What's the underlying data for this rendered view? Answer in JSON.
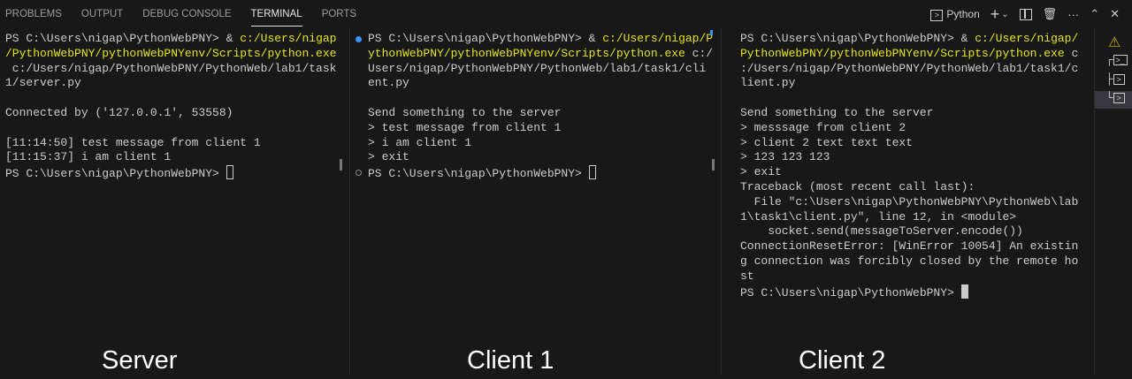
{
  "tabs": [
    {
      "label": "PROBLEMS"
    },
    {
      "label": "OUTPUT"
    },
    {
      "label": "DEBUG CONSOLE"
    },
    {
      "label": "TERMINAL",
      "active": true
    },
    {
      "label": "PORTS"
    }
  ],
  "toolbar": {
    "terminal_name": "Python",
    "icons": [
      "terminal-icon",
      "plus-icon",
      "chevron-down-icon",
      "split-icon",
      "trash-icon",
      "ellipsis-icon",
      "chevron-up-icon",
      "close-icon"
    ]
  },
  "colors": {
    "path_yellow": "#e5e510",
    "success_dot": "#3794ff",
    "background": "#181818"
  },
  "panes": [
    {
      "name": "server",
      "caption": "Server",
      "lines": [
        [
          {
            "t": "PS C:\\Users\\nigap\\PythonWebPNY> & "
          },
          {
            "t": "c:/Users/nigap",
            "y": true
          }
        ],
        [
          {
            "t": "/PythonWebPNY/pythonWebPNYenv/Scripts/python.exe",
            "y": true
          }
        ],
        [
          {
            "t": " c:/Users/nigap/PythonWebPNY/PythonWeb/lab1/task"
          }
        ],
        [
          {
            "t": "1/server.py"
          }
        ],
        [
          {
            "t": ""
          }
        ],
        [
          {
            "t": "Connected by ('127.0.0.1', 53558)"
          }
        ],
        [
          {
            "t": ""
          }
        ],
        [
          {
            "t": "[11:14:50] test message from client 1"
          }
        ],
        [
          {
            "t": "[11:15:37] i am client 1"
          }
        ],
        [
          {
            "t": "PS C:\\Users\\nigap\\PythonWebPNY> "
          }
        ]
      ]
    },
    {
      "name": "client-1",
      "caption": "Client 1",
      "lines": [
        [
          {
            "t": "PS C:\\Users\\nigap\\PythonWebPNY> & "
          },
          {
            "t": "c:/Users/nigap/P",
            "y": true
          }
        ],
        [
          {
            "t": "ythonWebPNY/pythonWebPNYenv/Scripts/python.exe",
            "y": true
          },
          {
            "t": " c:/"
          }
        ],
        [
          {
            "t": "Users/nigap/PythonWebPNY/PythonWeb/lab1/task1/cli"
          }
        ],
        [
          {
            "t": "ent.py"
          }
        ],
        [
          {
            "t": ""
          }
        ],
        [
          {
            "t": "Send something to the server"
          }
        ],
        [
          {
            "t": "> test message from client 1"
          }
        ],
        [
          {
            "t": "> i am client 1"
          }
        ],
        [
          {
            "t": "> exit"
          }
        ],
        [
          {
            "t": "PS C:\\Users\\nigap\\PythonWebPNY> "
          }
        ]
      ]
    },
    {
      "name": "client-2",
      "caption": "Client 2",
      "lines": [
        [
          {
            "t": "PS C:\\Users\\nigap\\PythonWebPNY> & "
          },
          {
            "t": "c:/Users/nigap/",
            "y": true
          }
        ],
        [
          {
            "t": "PythonWebPNY/pythonWebPNYenv/Scripts/python.exe",
            "y": true
          },
          {
            "t": " c"
          }
        ],
        [
          {
            "t": ":/Users/nigap/PythonWebPNY/PythonWeb/lab1/task1/c"
          }
        ],
        [
          {
            "t": "lient.py"
          }
        ],
        [
          {
            "t": ""
          }
        ],
        [
          {
            "t": "Send something to the server"
          }
        ],
        [
          {
            "t": "> messsage from client 2"
          }
        ],
        [
          {
            "t": "> client 2 text text text"
          }
        ],
        [
          {
            "t": "> 123 123 123"
          }
        ],
        [
          {
            "t": "> exit"
          }
        ],
        [
          {
            "t": "Traceback (most recent call last):"
          }
        ],
        [
          {
            "t": "  File \"c:\\Users\\nigap\\PythonWebPNY\\PythonWeb\\lab"
          }
        ],
        [
          {
            "t": "1\\task1\\client.py\", line 12, in <module>"
          }
        ],
        [
          {
            "t": "    socket.send(messageToServer.encode())"
          }
        ],
        [
          {
            "t": "ConnectionResetError: [WinError 10054] An existin"
          }
        ],
        [
          {
            "t": "g connection was forcibly closed by the remote ho"
          }
        ],
        [
          {
            "t": "st"
          }
        ],
        [
          {
            "t": "PS C:\\Users\\nigap\\PythonWebPNY> "
          }
        ]
      ]
    }
  ]
}
